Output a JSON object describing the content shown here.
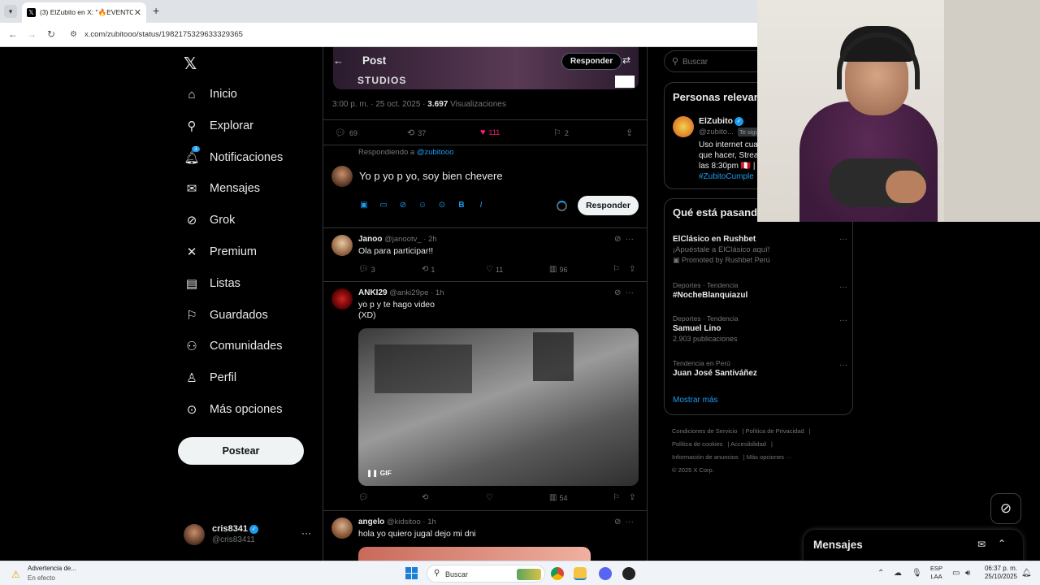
{
  "browser": {
    "tab_title": "(3) ElZubito en X: \"🔥EVENTO",
    "url": "x.com/zubitooo/status/1982175329633329365"
  },
  "sidebar": {
    "items": [
      {
        "label": "Inicio",
        "icon": "home-icon"
      },
      {
        "label": "Explorar",
        "icon": "search-icon"
      },
      {
        "label": "Notificaciones",
        "icon": "bell-icon",
        "badge": "3"
      },
      {
        "label": "Mensajes",
        "icon": "mail-icon"
      },
      {
        "label": "Grok",
        "icon": "grok-icon"
      },
      {
        "label": "Premium",
        "icon": "x-icon"
      },
      {
        "label": "Listas",
        "icon": "list-icon"
      },
      {
        "label": "Guardados",
        "icon": "bookmark-icon"
      },
      {
        "label": "Comunidades",
        "icon": "communities-icon"
      },
      {
        "label": "Perfil",
        "icon": "person-icon"
      },
      {
        "label": "Más opciones",
        "icon": "more-circle-icon"
      }
    ],
    "post_button": "Postear",
    "account": {
      "name": "cris8341",
      "handle": "@cris83411"
    }
  },
  "post": {
    "header_title": "Post",
    "reply_button_top": "Responder",
    "banner_text": "STUDIOS",
    "time": "3:00 p. m. · 25 oct. 2025 ·",
    "views_count": "3.697",
    "views_label": "Visualizaciones",
    "stats": {
      "replies": "69",
      "reposts": "37",
      "likes": "111",
      "bookmarks": "2"
    },
    "replying_prefix": "Respondiendo a",
    "replying_handle": "@zubitooo",
    "compose_text": "Yo p yo p yo, soy bien chevere",
    "reply_button": "Responder"
  },
  "replies": [
    {
      "name": "Janoo",
      "handle": "@janootv_",
      "time": "2h",
      "text": "Ola para participar!!",
      "replies": "3",
      "reposts": "1",
      "likes": "11",
      "views": "96"
    },
    {
      "name": "ANKI29",
      "handle": "@anki29pe",
      "time": "1h",
      "text": "yo p y te hago video",
      "text2": "(XD)",
      "gif_label": "GIF",
      "replies": "",
      "reposts": "",
      "likes": "",
      "views": "54"
    },
    {
      "name": "angelo",
      "handle": "@kidsitoo",
      "time": "1h",
      "text": "hola yo quiero jugal dejo mi dni"
    }
  ],
  "right": {
    "search_placeholder": "Buscar",
    "persons_title": "Personas relevantes",
    "person": {
      "name": "ElZubito",
      "handle": "@zubito...",
      "follows_tag": "Te sigue",
      "bio1": "Uso internet cua",
      "bio2": "que hacer, Strea",
      "bio3": "las 8:30pm 🇵🇪 |",
      "bio4": "#ZubitoCumple"
    },
    "trends_title": "Qué está pasando",
    "trends": [
      {
        "category": "",
        "name": "ElClásico en Rushbet",
        "sub": "¡Apuéstale a ElClásico aquí!",
        "promo": "Promoted by Rushbet Perú"
      },
      {
        "category": "Deportes · Tendencia",
        "name": "#NocheBlanquiazul",
        "sub": ""
      },
      {
        "category": "Deportes · Tendencia",
        "name": "Samuel Lino",
        "sub": "2.903 publicaciones"
      },
      {
        "category": "Tendencia en Perú",
        "name": "Juan José Santiváñez",
        "sub": ""
      }
    ],
    "show_more": "Mostrar más",
    "footer": {
      "l1a": "Condiciones de Servicio",
      "l1b": "Política de Privacidad",
      "l2a": "Política de cookies",
      "l2b": "Accesibilidad",
      "l3a": "Información de anuncios",
      "l3b": "Más opciones ···",
      "l4": "© 2025 X Corp."
    }
  },
  "messages_drawer": {
    "title": "Mensajes"
  },
  "taskbar": {
    "warning_title": "Advertencia de...",
    "warning_sub": "En efecto",
    "search_label": "Buscar",
    "lang1": "ESP",
    "lang2": "LAA",
    "time": "06:37 p. m.",
    "date": "25/10/2025"
  }
}
